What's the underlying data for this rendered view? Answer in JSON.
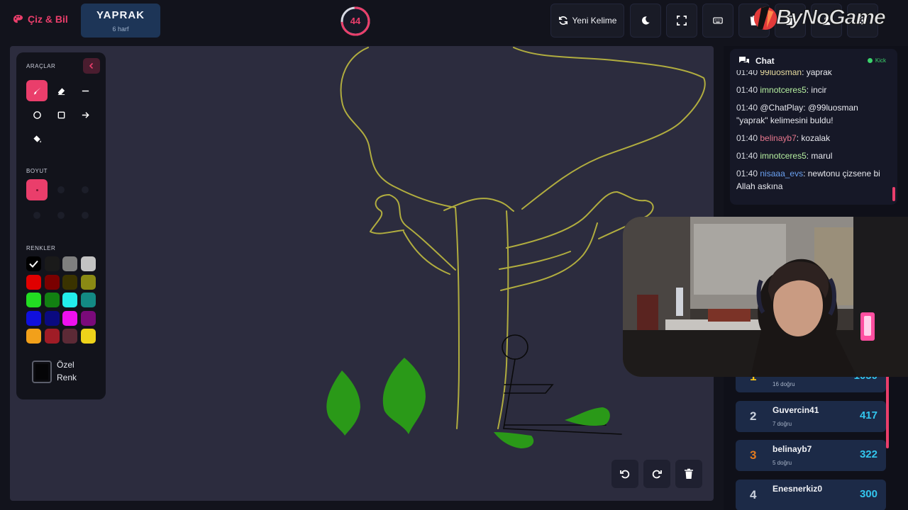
{
  "brand": {
    "name": "Çiz & Bil",
    "icon": "palette-icon"
  },
  "word": {
    "text": "YAPRAK",
    "hint": "6 harf"
  },
  "timer": {
    "seconds": "44",
    "fraction_remaining": 0.73,
    "color": "#ea3e6b"
  },
  "topbar": {
    "new_word_label": "Yeni Kelime",
    "buttons": [
      "refresh-icon",
      "moon-icon",
      "fullscreen-icon",
      "keyboard-icon",
      "trash-icon",
      "copy-icon",
      "users-icon",
      "settings-icon"
    ]
  },
  "watermark": {
    "text": "ByNoGame"
  },
  "tools": {
    "title": "ARAÇLAR",
    "items": [
      "brush-icon",
      "eraser-icon",
      "line-icon",
      "circle-icon",
      "square-icon",
      "arrow-icon",
      "fill-bucket-icon"
    ],
    "active_tool": "brush",
    "size_label": "BOYUT",
    "colors_label": "RENKLER",
    "custom_color_label": "Özel Renk",
    "palette": [
      "#000000",
      "#1a1a1a",
      "#7f7f7f",
      "#c3c3c3",
      "#e00000",
      "#7a0000",
      "#3a3300",
      "#8a8a14",
      "#22dd22",
      "#128012",
      "#22ecec",
      "#138a84",
      "#1010dd",
      "#0a0a80",
      "#ee10ee",
      "#7a0a7a",
      "#f2a01a",
      "#a01c26",
      "#5c2a36",
      "#eed21a"
    ],
    "selected_color": "#000000",
    "accent": "#ea3e6b"
  },
  "canvas": {
    "background": "#2c2c3e",
    "stroke_color_tree": "#b1ad3f",
    "leaf_color": "#2a9918"
  },
  "chat": {
    "title": "Chat",
    "platform": "Kick",
    "messages": [
      {
        "time": "01:40",
        "user": "99luosman",
        "user_color": "#e8dca0",
        "text": ": yaprak"
      },
      {
        "time": "01:40",
        "user": "imnotceres5",
        "user_color": "#b6f0a0",
        "text": ": incir"
      },
      {
        "time": "01:40",
        "user": "@ChatPlay",
        "user_color": "#e8e9ef",
        "text": ": @99luosman \"yaprak\" kelimesini buldu!"
      },
      {
        "time": "01:40",
        "user": "belinayb7",
        "user_color": "#e8778e",
        "text": ": kozalak"
      },
      {
        "time": "01:40",
        "user": "imnotceres5",
        "user_color": "#b6f0a0",
        "text": ": marul"
      },
      {
        "time": "01:40",
        "user": "nisaaa_evs",
        "user_color": "#6aa0f0",
        "text": ": newtonu çizsene bi Allah askına"
      }
    ]
  },
  "leaderboard": [
    {
      "rank": "1",
      "name": "",
      "sub": "16 doğru",
      "score": "1050",
      "rank_color": "#f2c21a"
    },
    {
      "rank": "2",
      "name": "Guvercin41",
      "sub": "7 doğru",
      "score": "417",
      "rank_color": "#c9d0dc"
    },
    {
      "rank": "3",
      "name": "belinayb7",
      "sub": "5 doğru",
      "score": "322",
      "rank_color": "#e07a20"
    },
    {
      "rank": "4",
      "name": "Enesnerkiz0",
      "sub": "",
      "score": "300",
      "rank_color": "#c9d0dc"
    }
  ],
  "undo_redo": [
    "undo-icon",
    "redo-icon",
    "trash-icon"
  ]
}
